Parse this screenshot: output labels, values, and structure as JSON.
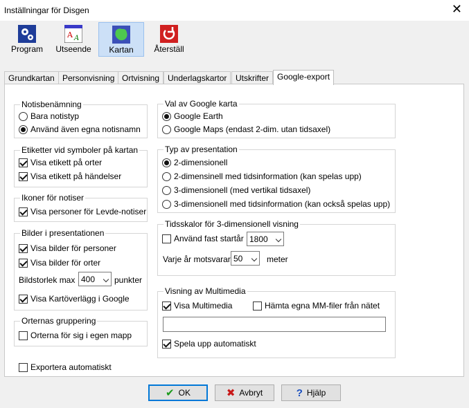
{
  "window": {
    "title": "Inställningar för Disgen"
  },
  "toolbar": {
    "items": [
      {
        "label": "Program",
        "icon": "gears-icon"
      },
      {
        "label": "Utseende",
        "icon": "font-style-icon"
      },
      {
        "label": "Kartan",
        "icon": "map-icon"
      },
      {
        "label": "Återställ",
        "icon": "reset-arrow-icon"
      }
    ],
    "active": "Kartan"
  },
  "tabs": [
    "Grundkartan",
    "Personvisning",
    "Ortvisning",
    "Underlagskartor",
    "Utskrifter",
    "Google-export"
  ],
  "selected_tab": "Google-export",
  "notis": {
    "title": "Notisbenämning",
    "opt1": "Bara notistyp",
    "opt2": "Använd även egna notisnamn",
    "selected": 2
  },
  "etiketter": {
    "title": "Etiketter vid symboler på kartan",
    "opt1": "Visa etikett på orter",
    "opt2": "Visa etikett på händelser"
  },
  "ikoner": {
    "title": "Ikoner för notiser",
    "opt1": "Visa personer för Levde-notiser"
  },
  "bilder": {
    "title": "Bilder i presentationen",
    "opt1": "Visa bilder för personer",
    "opt2": "Visa bilder för orter",
    "size_label": "Bildstorlek max",
    "size_value": "400",
    "size_unit": "punkter",
    "overlay": "Visa Kartöverlägg i Google"
  },
  "gruppering": {
    "title": "Orternas gruppering",
    "opt1": "Orterna för sig i egen mapp"
  },
  "export_auto": "Exportera automatiskt",
  "karta": {
    "title": "Val av Google karta",
    "opt1": "Google Earth",
    "opt2": "Google Maps (endast 2-dim. utan tidsaxel)",
    "selected": 1
  },
  "presentation": {
    "title": "Typ av presentation",
    "opt1": "2-dimensionell",
    "opt2": "2-dimensinell med tidsinformation (kan spelas upp)",
    "opt3": "3-dimensionell (med vertikal tidsaxel)",
    "opt4": "3-dimensionell med tidsinformation (kan också spelas upp)",
    "selected": 1
  },
  "tidsskalor": {
    "title": "Tidsskalor för 3-dimensionell visning",
    "fixed_start": "Använd fast startår",
    "start_value": "1800",
    "per_year_label": "Varje år motsvarar",
    "per_year_value": "50",
    "per_year_unit": "meter"
  },
  "multimedia": {
    "title": "Visning av  Multimedia",
    "show": "Visa Multimedia",
    "fetch": "Hämta egna MM-filer från nätet",
    "path_value": "",
    "autoplay": "Spela upp  automatiskt"
  },
  "buttons": {
    "ok": "OK",
    "cancel": "Avbryt",
    "help": "Hjälp"
  },
  "colors": {
    "active_tool": "#cce0f7",
    "default_button_border": "#0078d7"
  }
}
